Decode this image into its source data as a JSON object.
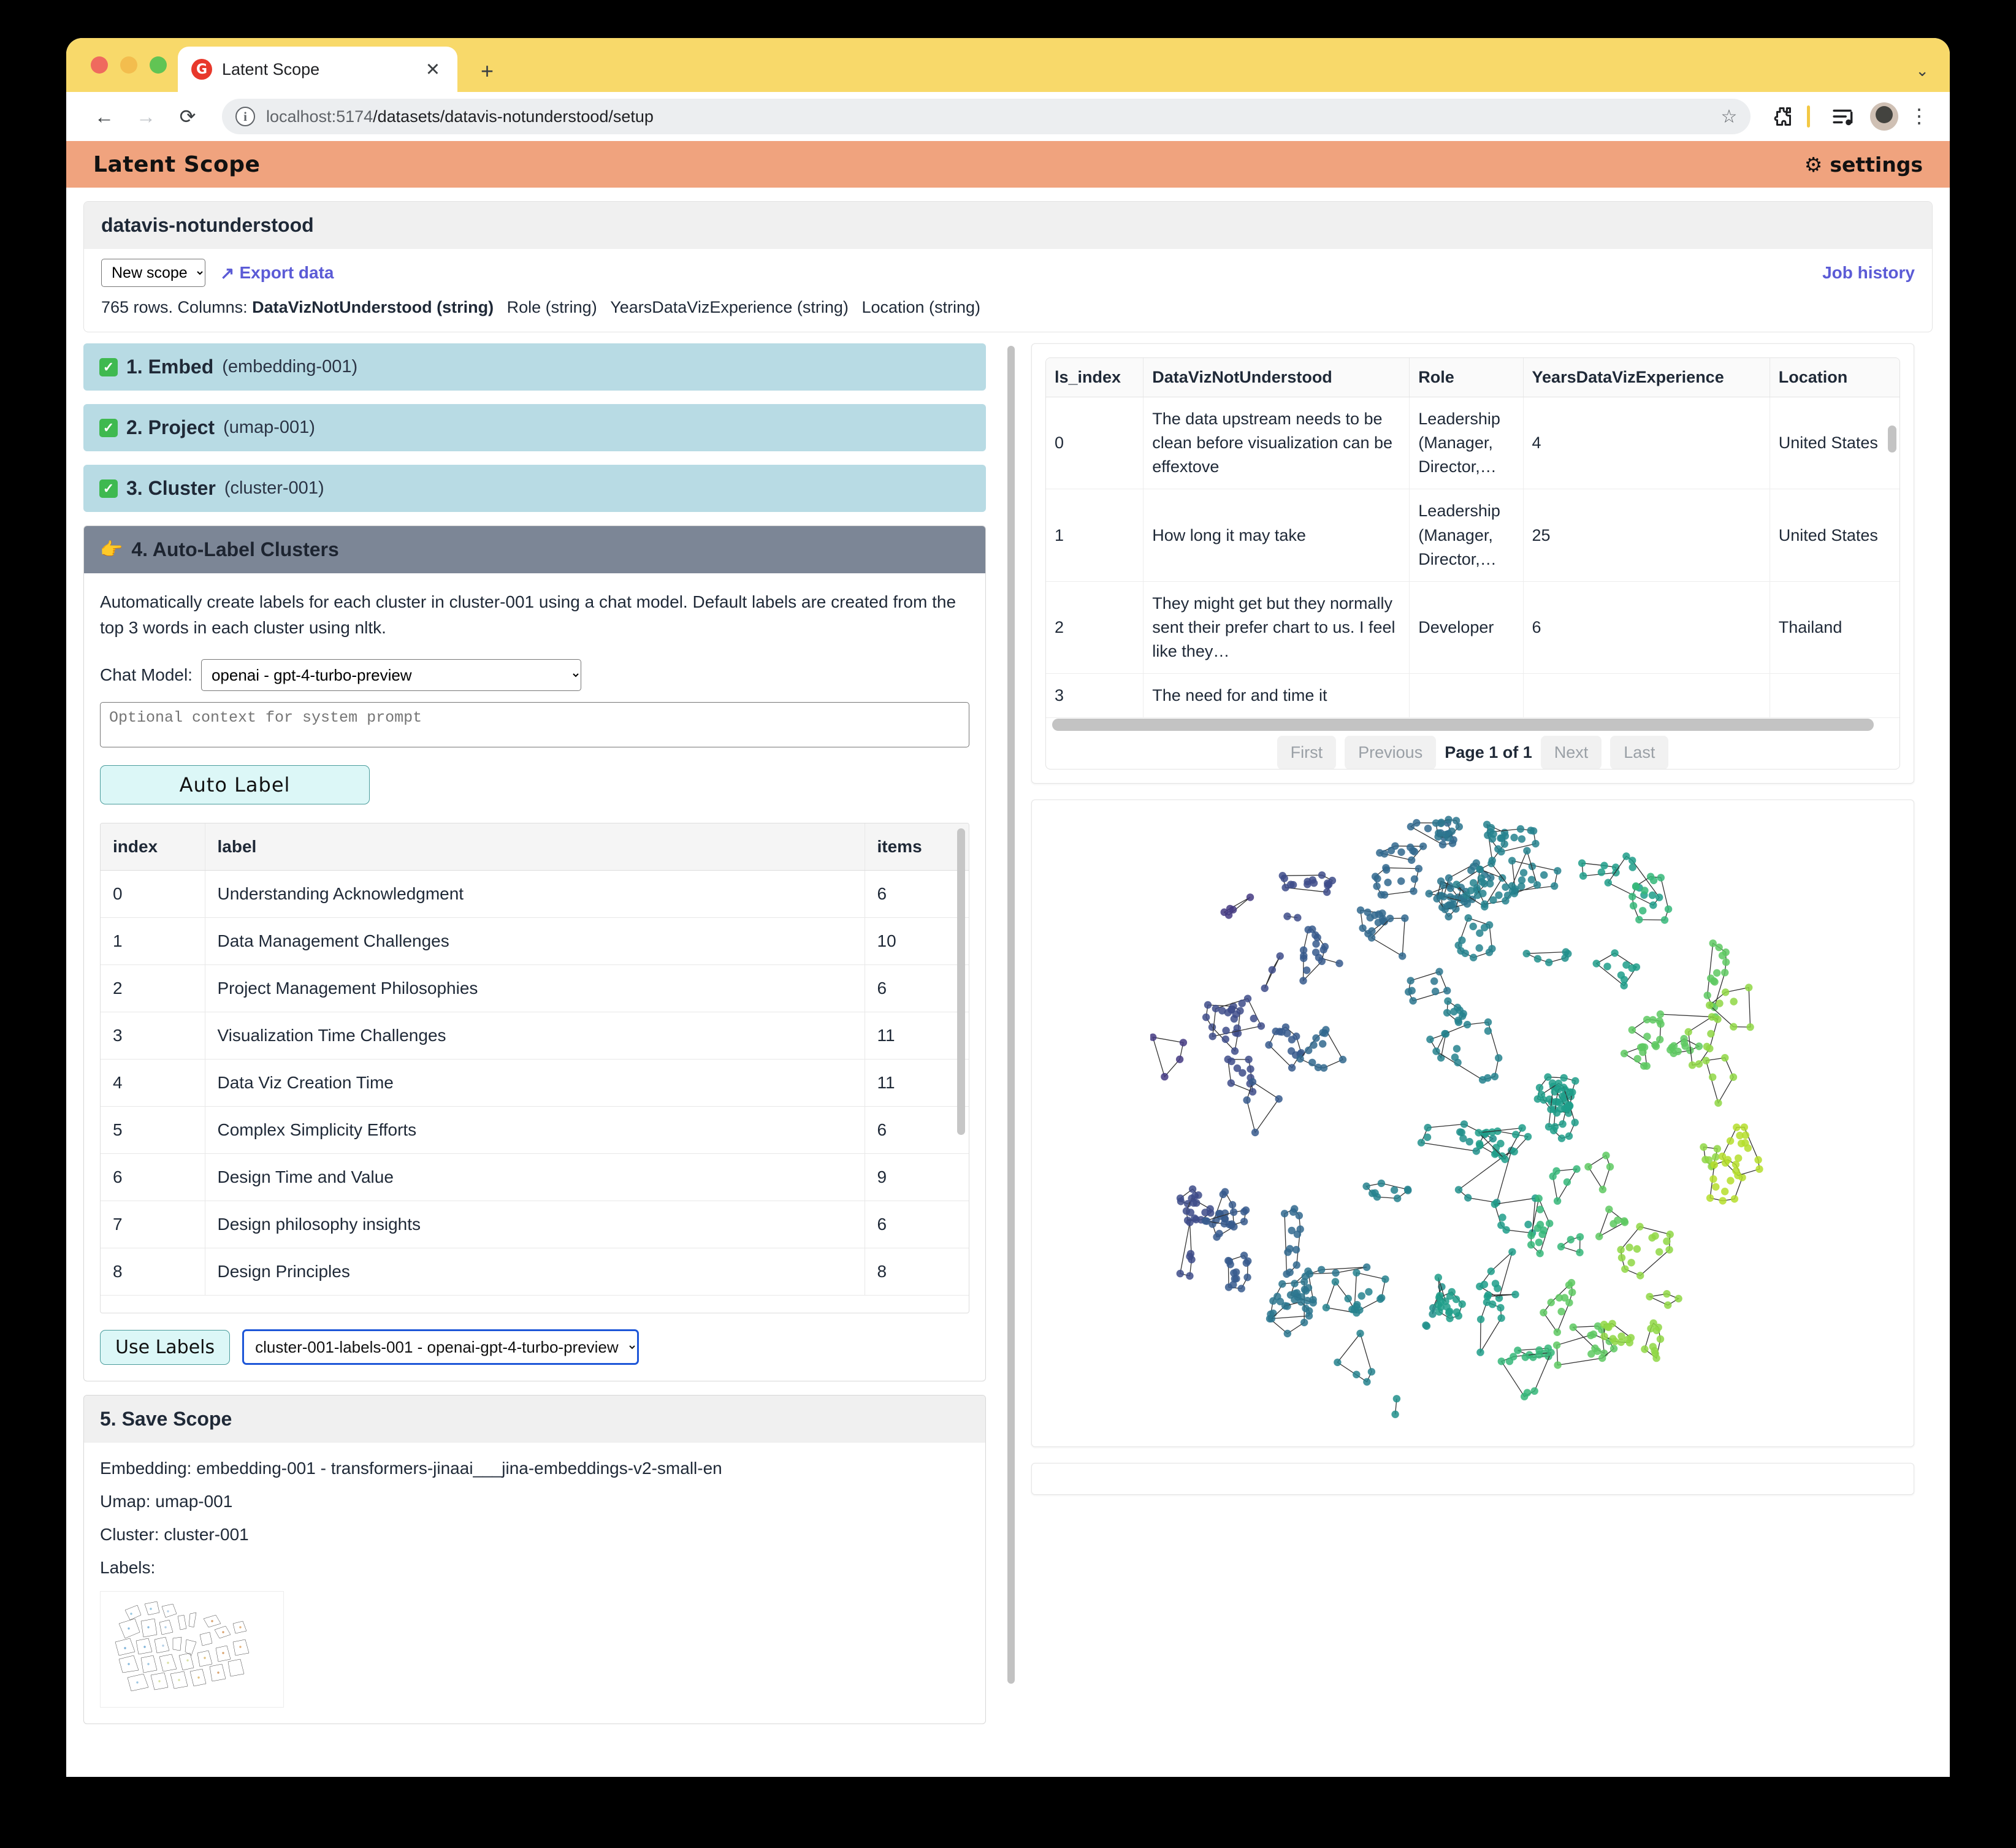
{
  "browser": {
    "tab_title": "Latent Scope",
    "favicon_letter": "G",
    "close_label": "✕",
    "new_tab_label": "+",
    "tabstrip_caret": "⌄",
    "back_icon": "←",
    "forward_icon": "→",
    "reload_icon": "⟳",
    "url_host": "localhost:5174",
    "url_path": "/datasets/datavis-notunderstood/setup",
    "star_icon": "☆",
    "kebab_icon": "⋮"
  },
  "app": {
    "title": "Latent Scope",
    "settings_label": "settings",
    "settings_icon": "⚙"
  },
  "dataset": {
    "name": "datavis-notunderstood",
    "scope_select_value": "New scope",
    "export_label": "Export data",
    "export_icon": "↗",
    "job_history_label": "Job history",
    "summary_prefix": "765 rows. Columns:",
    "columns": [
      "DataVizNotUnderstood (string)",
      "Role (string)",
      "YearsDataVizExperience (string)",
      "Location (string)"
    ]
  },
  "steps": [
    {
      "icon": "✅",
      "num": "1. Embed",
      "sub": "(embedding-001)",
      "state": "done"
    },
    {
      "icon": "✅",
      "num": "2. Project",
      "sub": "(umap-001)",
      "state": "done"
    },
    {
      "icon": "✅",
      "num": "3. Cluster",
      "sub": "(cluster-001)",
      "state": "done"
    }
  ],
  "autolabel": {
    "heading": "4. Auto-Label Clusters",
    "heading_icon": "👉",
    "description": "Automatically create labels for each cluster in cluster-001 using a chat model. Default labels are created from the top 3 words in each cluster using nltk.",
    "chat_model_label": "Chat Model:",
    "chat_model_value": "openai - gpt-4-turbo-preview",
    "prompt_placeholder": "Optional context for system prompt",
    "prompt_value": "",
    "auto_label_button": "Auto Label",
    "use_labels_button": "Use Labels",
    "labels_select_value": "cluster-001-labels-001 - openai-gpt-4-turbo-preview",
    "table": {
      "headers": [
        "index",
        "label",
        "items"
      ],
      "rows": [
        [
          "0",
          "Understanding Acknowledgment",
          "6"
        ],
        [
          "1",
          "Data Management Challenges",
          "10"
        ],
        [
          "2",
          "Project Management Philosophies",
          "6"
        ],
        [
          "3",
          "Visualization Time Challenges",
          "11"
        ],
        [
          "4",
          "Data Viz Creation Time",
          "11"
        ],
        [
          "5",
          "Complex Simplicity Efforts",
          "6"
        ],
        [
          "6",
          "Design Time and Value",
          "9"
        ],
        [
          "7",
          "Design philosophy insights",
          "6"
        ],
        [
          "8",
          "Design Principles",
          "8"
        ]
      ]
    }
  },
  "save_scope": {
    "heading": "5. Save Scope",
    "embedding_line": "Embedding: embedding-001 - transformers-jinaai___jina-embeddings-v2-small-en",
    "umap_line": "Umap: umap-001",
    "cluster_line": "Cluster: cluster-001",
    "labels_line": "Labels:"
  },
  "data_table": {
    "headers": [
      "ls_index",
      "DataVizNotUnderstood",
      "Role",
      "YearsDataVizExperience",
      "Location"
    ],
    "rows": [
      [
        "0",
        "The data upstream needs to be clean before visualization can be effextove",
        "Leadership (Manager, Director,…",
        "4",
        "United States"
      ],
      [
        "1",
        "How long it may take",
        "Leadership (Manager, Director,…",
        "25",
        "United States"
      ],
      [
        "2",
        "They might get but they normally sent their prefer chart to us. I feel like they…",
        "Developer",
        "6",
        "Thailand"
      ],
      [
        "3",
        "The need for and time it",
        "",
        "",
        ""
      ]
    ],
    "pager": {
      "first": "First",
      "previous": "Previous",
      "page_text": "Page 1 of 1",
      "next": "Next",
      "last": "Last"
    }
  },
  "chart_data": {
    "type": "scatter",
    "title": "",
    "xlabel": "",
    "ylabel": "",
    "grid": false,
    "legend": "none",
    "colormap": "viridis",
    "description": "UMAP 2-D projection of 765 text rows coloured by cluster, each cluster outlined by a convex hull polygon",
    "n_points": 765,
    "n_clusters": 96,
    "palette": [
      "#482878",
      "#443a83",
      "#3e4c8a",
      "#375b8d",
      "#31688e",
      "#2b758e",
      "#26828e",
      "#21918c",
      "#1f9e89",
      "#35b779",
      "#5ec962",
      "#8fd744",
      "#b5de2b",
      "#c8e020"
    ],
    "xlim": [
      0,
      1
    ],
    "ylim": [
      0,
      1
    ]
  }
}
